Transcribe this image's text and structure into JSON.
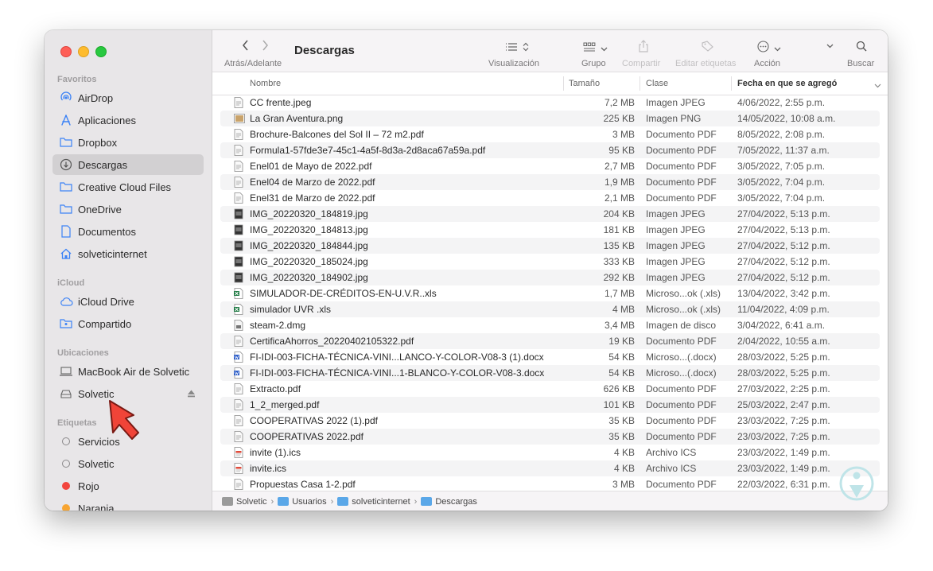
{
  "sidebar": {
    "sections": {
      "favoritos": "Favoritos",
      "icloud": "iCloud",
      "ubicaciones": "Ubicaciones",
      "etiquetas": "Etiquetas"
    },
    "favorites": [
      {
        "label": "AirDrop",
        "icon": "airdrop-icon"
      },
      {
        "label": "Aplicaciones",
        "icon": "applications-icon"
      },
      {
        "label": "Dropbox",
        "icon": "folder-icon"
      },
      {
        "label": "Descargas",
        "icon": "downloads-icon",
        "selected": true
      },
      {
        "label": "Creative Cloud Files",
        "icon": "folder-icon"
      },
      {
        "label": "OneDrive",
        "icon": "folder-icon"
      },
      {
        "label": "Documentos",
        "icon": "document-icon"
      },
      {
        "label": "solveticinternet",
        "icon": "home-icon"
      }
    ],
    "icloud": [
      {
        "label": "iCloud Drive",
        "icon": "cloud-icon"
      },
      {
        "label": "Compartido",
        "icon": "shared-folder-icon"
      }
    ],
    "locations": [
      {
        "label": "MacBook Air de Solvetic",
        "icon": "laptop-icon"
      },
      {
        "label": "Solvetic",
        "icon": "disk-icon"
      }
    ],
    "tags": [
      {
        "label": "Servicios",
        "color": "none"
      },
      {
        "label": "Solvetic",
        "color": "none"
      },
      {
        "label": "Rojo",
        "color": "#f2453d"
      },
      {
        "label": "Naranja",
        "color": "#f7a532"
      }
    ]
  },
  "toolbar": {
    "nav_label": "Atrás/Adelante",
    "title": "Descargas",
    "view_label": "Visualización",
    "group_label": "Grupo",
    "share_label": "Compartir",
    "tags_label": "Editar etiquetas",
    "action_label": "Acción",
    "search_label": "Buscar"
  },
  "columns": {
    "name": "Nombre",
    "size": "Tamaño",
    "kind": "Clase",
    "date": "Fecha en que se agregó"
  },
  "files": [
    {
      "name": "CC frente.jpeg",
      "size": "7,2 MB",
      "kind": "Imagen JPEG",
      "date": "4/06/2022, 2:55 p.m.",
      "icon": "jpeg-file-icon"
    },
    {
      "name": "La Gran Aventura.png",
      "size": "225 KB",
      "kind": "Imagen PNG",
      "date": "14/05/2022, 10:08 a.m.",
      "icon": "png-file-icon"
    },
    {
      "name": "Brochure-Balcones del Sol II – 72 m2.pdf",
      "size": "3 MB",
      "kind": "Documento PDF",
      "date": "8/05/2022, 2:08 p.m.",
      "icon": "pdf-file-icon"
    },
    {
      "name": "Formula1-57fde3e7-45c1-4a5f-8d3a-2d8aca67a59a.pdf",
      "size": "95 KB",
      "kind": "Documento PDF",
      "date": "7/05/2022, 11:37 a.m.",
      "icon": "pdf-file-icon"
    },
    {
      "name": "Enel01 de Mayo de 2022.pdf",
      "size": "2,7 MB",
      "kind": "Documento PDF",
      "date": "3/05/2022, 7:05 p.m.",
      "icon": "pdf-file-icon"
    },
    {
      "name": "Enel04 de Marzo de 2022.pdf",
      "size": "1,9 MB",
      "kind": "Documento PDF",
      "date": "3/05/2022, 7:04 p.m.",
      "icon": "pdf-file-icon"
    },
    {
      "name": "Enel31 de Marzo de 2022.pdf",
      "size": "2,1 MB",
      "kind": "Documento PDF",
      "date": "3/05/2022, 7:04 p.m.",
      "icon": "pdf-file-icon"
    },
    {
      "name": "IMG_20220320_184819.jpg",
      "size": "204 KB",
      "kind": "Imagen JPEG",
      "date": "27/04/2022, 5:13 p.m.",
      "icon": "photo-file-icon"
    },
    {
      "name": "IMG_20220320_184813.jpg",
      "size": "181 KB",
      "kind": "Imagen JPEG",
      "date": "27/04/2022, 5:13 p.m.",
      "icon": "photo-file-icon"
    },
    {
      "name": "IMG_20220320_184844.jpg",
      "size": "135 KB",
      "kind": "Imagen JPEG",
      "date": "27/04/2022, 5:12 p.m.",
      "icon": "photo-file-icon"
    },
    {
      "name": "IMG_20220320_185024.jpg",
      "size": "333 KB",
      "kind": "Imagen JPEG",
      "date": "27/04/2022, 5:12 p.m.",
      "icon": "photo-file-icon"
    },
    {
      "name": "IMG_20220320_184902.jpg",
      "size": "292 KB",
      "kind": "Imagen JPEG",
      "date": "27/04/2022, 5:12 p.m.",
      "icon": "photo-file-icon"
    },
    {
      "name": "SIMULADOR-DE-CRÉDITOS-EN-U.V.R..xls",
      "size": "1,7 MB",
      "kind": "Microso...ok (.xls)",
      "date": "13/04/2022, 3:42 p.m.",
      "icon": "excel-file-icon"
    },
    {
      "name": "simulador UVR .xls",
      "size": "4 MB",
      "kind": "Microso...ok (.xls)",
      "date": "11/04/2022, 4:09 p.m.",
      "icon": "excel-file-icon"
    },
    {
      "name": "steam-2.dmg",
      "size": "3,4 MB",
      "kind": "Imagen de disco",
      "date": "3/04/2022, 6:41 a.m.",
      "icon": "dmg-file-icon"
    },
    {
      "name": "CertificaAhorros_20220402105322.pdf",
      "size": "19 KB",
      "kind": "Documento PDF",
      "date": "2/04/2022, 10:55 a.m.",
      "icon": "pdf-file-icon"
    },
    {
      "name": "FI-IDI-003-FICHA-TÉCNICA-VINI...LANCO-Y-COLOR-V08-3 (1).docx",
      "size": "54 KB",
      "kind": "Microso...(.docx)",
      "date": "28/03/2022, 5:25 p.m.",
      "icon": "word-file-icon"
    },
    {
      "name": "FI-IDI-003-FICHA-TÉCNICA-VINI...1-BLANCO-Y-COLOR-V08-3.docx",
      "size": "54 KB",
      "kind": "Microso...(.docx)",
      "date": "28/03/2022, 5:25 p.m.",
      "icon": "word-file-icon"
    },
    {
      "name": "Extracto.pdf",
      "size": "626 KB",
      "kind": "Documento PDF",
      "date": "27/03/2022, 2:25 p.m.",
      "icon": "pdf-file-icon"
    },
    {
      "name": "1_2_merged.pdf",
      "size": "101 KB",
      "kind": "Documento PDF",
      "date": "25/03/2022, 2:47 p.m.",
      "icon": "pdf-file-icon"
    },
    {
      "name": "COOPERATIVAS 2022 (1).pdf",
      "size": "35 KB",
      "kind": "Documento PDF",
      "date": "23/03/2022, 7:25 p.m.",
      "icon": "pdf-file-icon"
    },
    {
      "name": "COOPERATIVAS 2022.pdf",
      "size": "35 KB",
      "kind": "Documento PDF",
      "date": "23/03/2022, 7:25 p.m.",
      "icon": "pdf-file-icon"
    },
    {
      "name": "invite (1).ics",
      "size": "4 KB",
      "kind": "Archivo ICS",
      "date": "23/03/2022, 1:49 p.m.",
      "icon": "ics-file-icon"
    },
    {
      "name": "invite.ics",
      "size": "4 KB",
      "kind": "Archivo ICS",
      "date": "23/03/2022, 1:49 p.m.",
      "icon": "ics-file-icon"
    },
    {
      "name": "Propuestas Casa 1-2.pdf",
      "size": "3 MB",
      "kind": "Documento PDF",
      "date": "22/03/2022, 6:31 p.m.",
      "icon": "pdf-file-icon"
    }
  ],
  "pathbar": [
    "Solvetic",
    "Usuarios",
    "solveticinternet",
    "Descargas"
  ]
}
